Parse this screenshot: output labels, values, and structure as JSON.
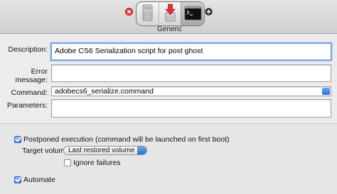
{
  "toolbar": {
    "caption": "Generic",
    "buttons": [
      {
        "icon": "disk-icon"
      },
      {
        "icon": "download-arrow-icon"
      },
      {
        "icon": "terminal-icon"
      }
    ]
  },
  "form": {
    "description_label": "Description:",
    "description_value": "Adobe CS6 Serialization script for post ghost",
    "error_label": "Error message:",
    "error_value": "",
    "command_label": "Command:",
    "command_value": "adobecs6_serialize.command",
    "parameters_label": "Parameters:",
    "parameters_value": ""
  },
  "options": {
    "postponed_label": "Postponed execution (command will be launched on first boot)",
    "postponed_checked": true,
    "target_volume_label": "Target volume:",
    "target_volume_value": "Last restored volume",
    "ignore_failures_label": "Ignore failures",
    "ignore_failures_checked": false,
    "automate_label": "Automate",
    "automate_checked": true
  },
  "colors": {
    "accent": "#3b7fdc",
    "remove": "#e0353a"
  }
}
